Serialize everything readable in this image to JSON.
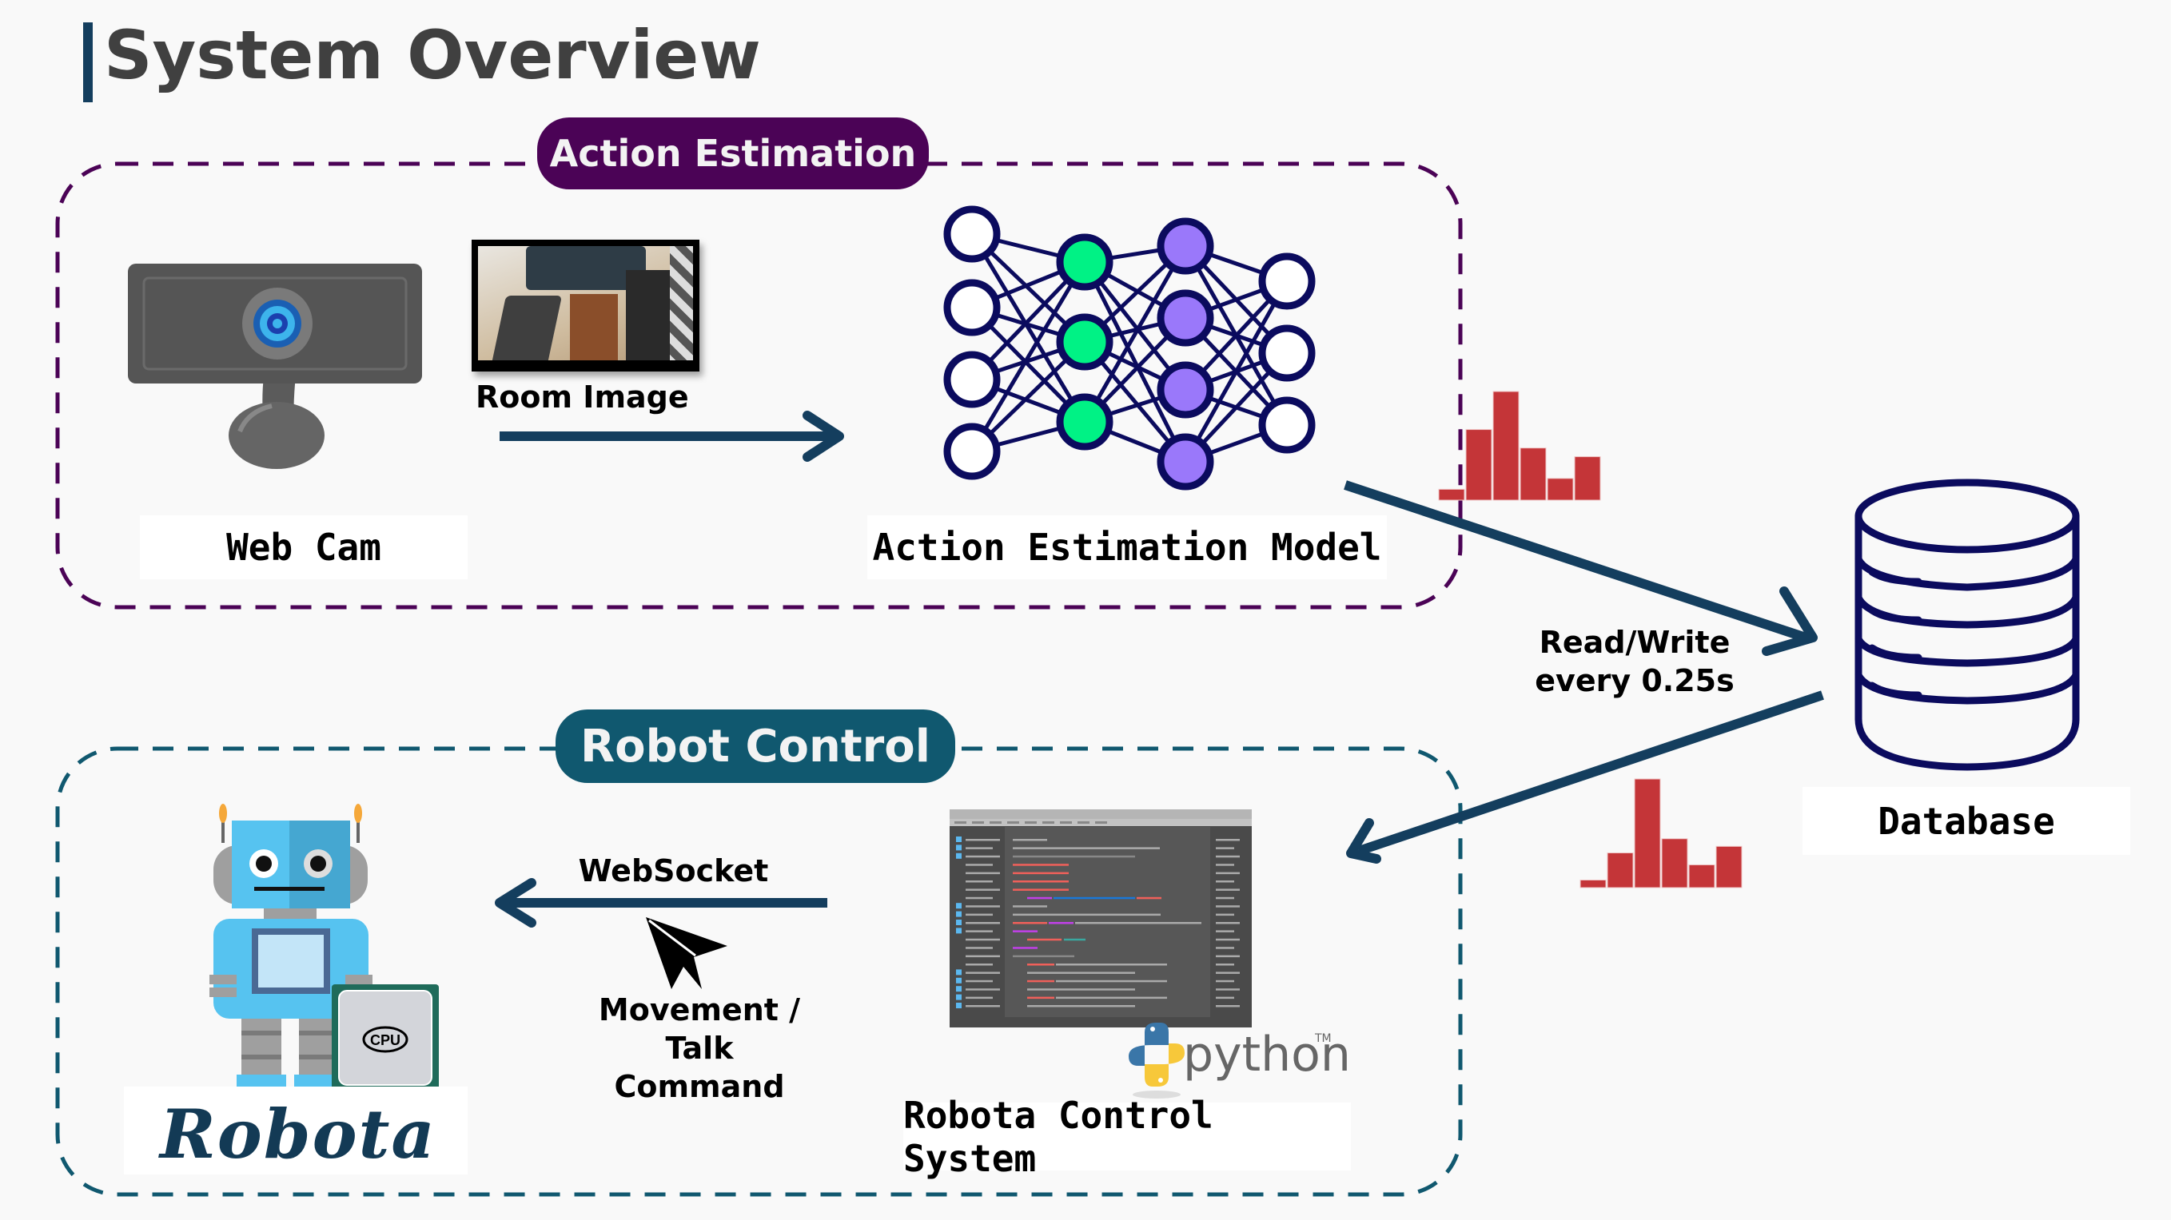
{
  "page": {
    "title": "System Overview"
  },
  "sections": {
    "action_estimation": {
      "label": "Action Estimation",
      "color": "#4b0356",
      "webcam_label": "Web Cam",
      "room_image_label": "Room Image",
      "model_label": "Action Estimation Model"
    },
    "robot_control": {
      "label": "Robot Control",
      "color": "#10586f",
      "websocket_label": "WebSocket",
      "command_label_lines": [
        "Movement /",
        "Talk",
        "Command"
      ],
      "control_system_label": "Robota Control System",
      "robot_logo": "Robota",
      "cpu_label": "CPU",
      "python_logo": "python",
      "python_tm": "TM"
    }
  },
  "database": {
    "label": "Database",
    "io_label_lines": [
      "Read/Write",
      "every 0.25s"
    ]
  },
  "colors": {
    "arrow": "#143e5e",
    "histogram": "#c43538",
    "nn_stroke": "#0b0b5e",
    "nn_green": "#00f285",
    "nn_purple": "#9a78fa"
  },
  "neural_network": {
    "layers": [
      4,
      3,
      4,
      3
    ]
  },
  "histograms": {
    "upper": [
      0.1,
      0.65,
      1.0,
      0.48,
      0.2,
      0.4
    ],
    "lower": [
      0.07,
      0.32,
      1.0,
      0.45,
      0.21,
      0.38
    ]
  }
}
